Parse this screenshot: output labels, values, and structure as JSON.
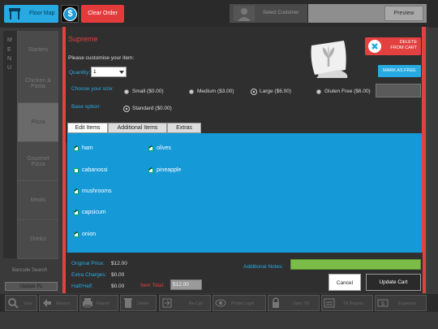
{
  "topbar": {
    "floor_map_label": "Floor Map",
    "currency_icon": "$",
    "clear_order_label": "Clear Order",
    "select_customer_label": "Select Customer",
    "preview_label": "Preview"
  },
  "menu": {
    "letters": [
      "M",
      "E",
      "N",
      "U"
    ],
    "categories": [
      {
        "label": "Starters"
      },
      {
        "label": "Chicken &\nPasta"
      },
      {
        "label": "Pizza"
      },
      {
        "label": "Gourmet\nPizza"
      },
      {
        "label": "Meals"
      },
      {
        "label": "Drinks"
      }
    ],
    "barcode_search_label": "Barcode Search",
    "update_label": "Update PL"
  },
  "bottombar": {
    "items": [
      {
        "label": "View",
        "icon": "search-icon"
      },
      {
        "label": "Returns",
        "icon": "return-icon"
      },
      {
        "label": "Reprint",
        "icon": "printer-icon"
      },
      {
        "label": "Delete",
        "icon": "trash-icon"
      },
      {
        "label": "Re-Call",
        "icon": "recall-icon"
      },
      {
        "label": "Printer Login",
        "icon": "eye-icon"
      },
      {
        "label": "Open Till",
        "icon": "lock-icon"
      },
      {
        "label": "Till Reports",
        "icon": "report-icon"
      },
      {
        "label": "Expenses",
        "icon": "cash-icon"
      }
    ]
  },
  "item": {
    "title": "Supreme",
    "customise_label": "Please customise your item:",
    "quantity_label": "Quantity:",
    "quantity_value": "1",
    "delete_label_line1": "DELETE",
    "delete_label_line2": "FROM CART",
    "mark_free_label": "MARK AS FREE",
    "size_label": "Choose your size:",
    "sizes": [
      {
        "label": "Small ($0.00)",
        "selected": false
      },
      {
        "label": "Medium ($3.00)",
        "selected": false
      },
      {
        "label": "Large ($6.00)",
        "selected": true
      },
      {
        "label": "Gluten Free ($6.00)",
        "selected": false
      }
    ],
    "base_label": "Base option:",
    "bases": [
      {
        "label": "Standard ($0.00)",
        "selected": true
      }
    ]
  },
  "tabs": [
    {
      "label": "Edit Items",
      "active": true
    },
    {
      "label": "Additional Items",
      "active": false
    },
    {
      "label": "Extras",
      "active": false
    }
  ],
  "ingredients": [
    {
      "label": "ham",
      "checked": true
    },
    {
      "label": "olives",
      "checked": true
    },
    {
      "label": "cabanossi",
      "checked": false
    },
    {
      "label": "pineapple",
      "checked": true
    },
    {
      "label": "mushrooms",
      "checked": true
    },
    {
      "label": "capsicum",
      "checked": true
    },
    {
      "label": "onion",
      "checked": true
    }
  ],
  "pricing": {
    "original_price_label": "Original Price:",
    "original_price_value": "$12.00",
    "extra_charges_label": "Extra Charges:",
    "extra_charges_value": "$0.00",
    "half_half_label": "Half/Half:",
    "half_half_value": "$0.00",
    "item_total_label": "Item Total:",
    "item_total_value": "$12.00"
  },
  "notes": {
    "label": "Additional Notes:",
    "value": ""
  },
  "actions": {
    "cancel_label": "Cancel",
    "update_cart_label": "Update Cart"
  },
  "colors": {
    "accent_blue": "#27aae1",
    "accent_red": "#e2413f",
    "list_blue": "#1599d7",
    "notes_green": "#7cbd4a"
  }
}
